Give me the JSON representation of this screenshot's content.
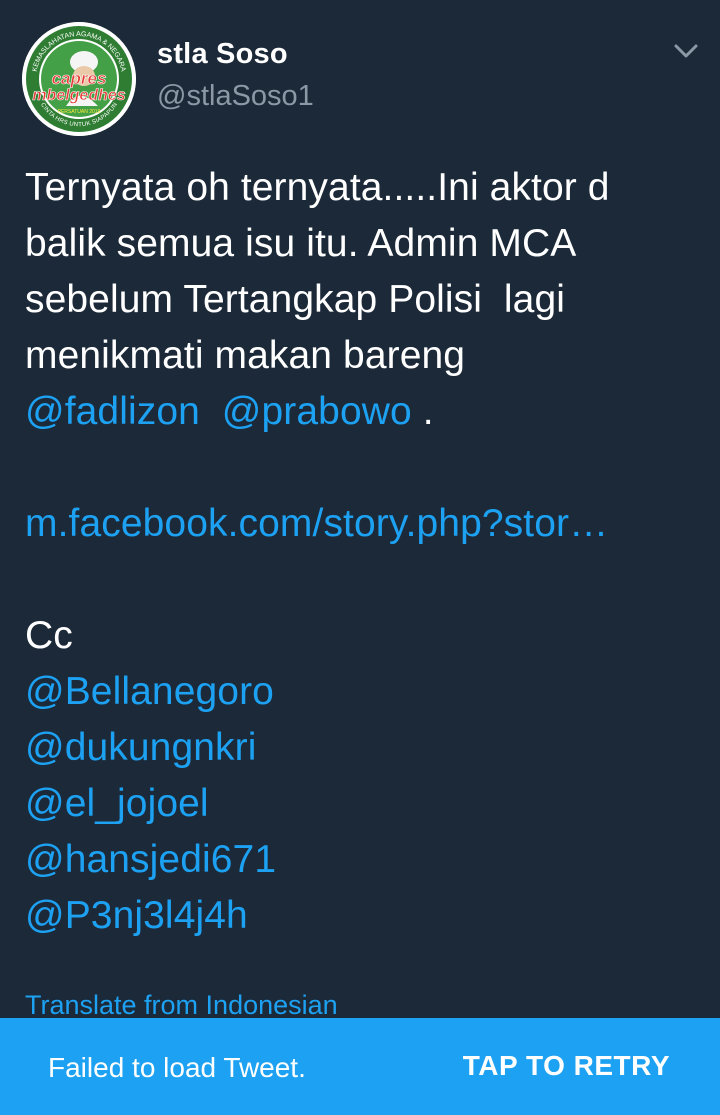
{
  "user": {
    "display_name": "stla Soso",
    "handle": "@stlaSoso1",
    "avatar_text_top": "KEMASLAHATAN AGAMA & NEGARA",
    "avatar_text_main1": "capres",
    "avatar_text_main2": "mbelgedhes",
    "avatar_text_small": "PERSATUAN 2019",
    "avatar_text_bottom": "CINTA HRS UNTUK SIAPAPUN",
    "icons": {
      "menu": "chevron-down-icon"
    }
  },
  "tweet": {
    "line1": "Ternyata oh ternyata.....Ini aktor d",
    "line2": "balik semua isu itu. Admin MCA",
    "line3": "sebelum Tertangkap Polisi  lagi",
    "line4": "menikmati makan bareng",
    "mention_fadlizon": "@fadlizon",
    "mention_prabowo": "@prabowo",
    "period": ".",
    "link": "m.facebook.com/story.php?stor…",
    "cc": "Cc",
    "mentions": [
      "@Bellanegoro",
      "@dukungnkri",
      "@el_jojoel",
      "@hansjedi671",
      "@P3nj3l4j4h"
    ]
  },
  "translate_label": "Translate from Indonesian",
  "snackbar": {
    "message": "Failed to load Tweet.",
    "action": "TAP TO RETRY"
  },
  "colors": {
    "background": "#1c2938",
    "link": "#1da1f2",
    "muted": "#8b98a5",
    "snackbar": "#1da1f2"
  }
}
